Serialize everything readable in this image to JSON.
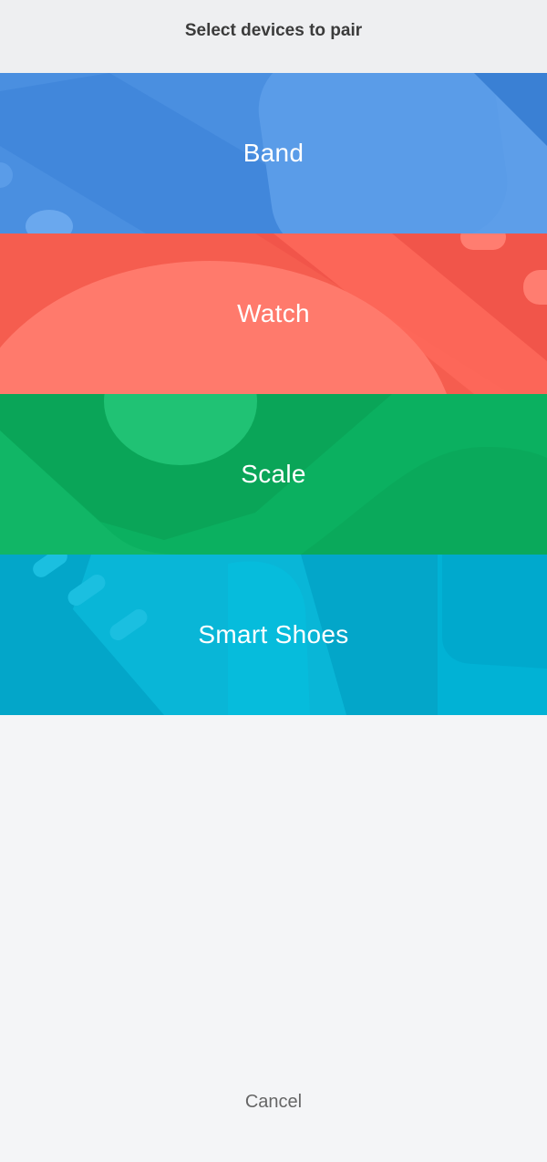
{
  "header": {
    "title": "Select devices to pair"
  },
  "devices": [
    {
      "label": "Band",
      "color": "#4a90e2"
    },
    {
      "label": "Watch",
      "color": "#f65a4c"
    },
    {
      "label": "Scale",
      "color": "#0db25f"
    },
    {
      "label": "Smart Shoes",
      "color": "#00a9cd"
    }
  ],
  "footer": {
    "cancel_label": "Cancel"
  }
}
